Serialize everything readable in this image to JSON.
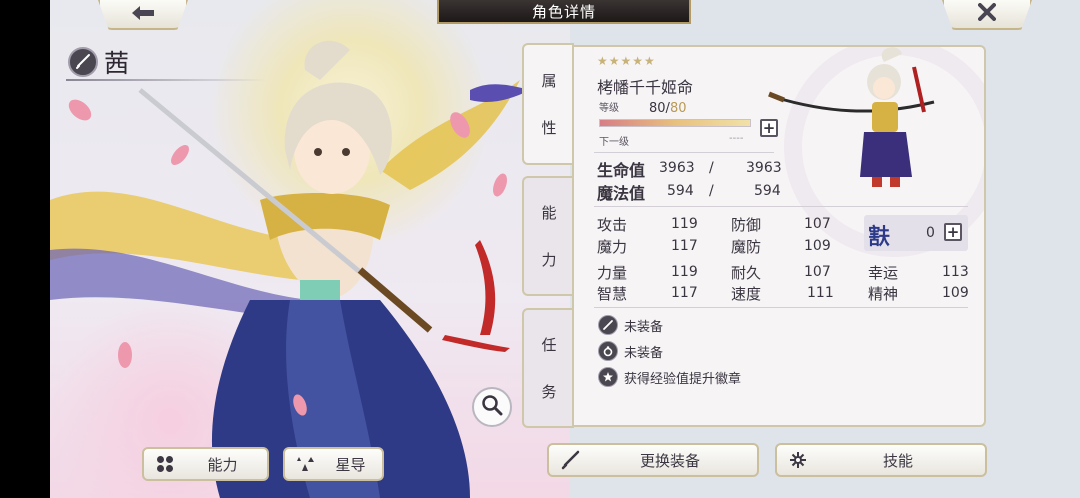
{
  "header": {
    "back_icon": "arrow-left-icon",
    "title": "角色详情",
    "close_icon": "close-x-icon"
  },
  "character": {
    "short_name": "茜",
    "full_name": "栲幡千千姬命",
    "stars": "★★★★★",
    "level_label": "等级",
    "level_current": "80",
    "level_sep": "/",
    "level_max": "80",
    "exp_progress": 1.0,
    "next_label": "下一级",
    "next_value": "----"
  },
  "tabs": {
    "attributes": [
      "属",
      "性"
    ],
    "ability": [
      "能",
      "力"
    ],
    "task": [
      "任",
      "务"
    ]
  },
  "stats": {
    "hp_label": "生命值",
    "hp_current": "3963",
    "hp_max": "3963",
    "mp_label": "魔法值",
    "mp_current": "594",
    "mp_max": "594",
    "slash": "/",
    "grid": [
      {
        "label": "攻击",
        "value": "119"
      },
      {
        "label": "防御",
        "value": "107"
      },
      {
        "label": "魔力",
        "value": "117"
      },
      {
        "label": "魔防",
        "value": "109"
      },
      {
        "label": "力量",
        "value": "119"
      },
      {
        "label": "耐久",
        "value": "107"
      },
      {
        "label": "幸运",
        "value": "113"
      },
      {
        "label": "智慧",
        "value": "117"
      },
      {
        "label": "速度",
        "value": "111"
      },
      {
        "label": "精神",
        "value": "109"
      }
    ],
    "rune_glyph": "㝬",
    "rune_value": "0"
  },
  "equipment": [
    {
      "icon": "sword-slot-icon",
      "label": "未装备"
    },
    {
      "icon": "ring-slot-icon",
      "label": "未装备"
    },
    {
      "icon": "badge-star-icon",
      "label": "获得经验值提升徽章"
    }
  ],
  "buttons": {
    "ability": "能力",
    "star_guide": "星导",
    "change_equipment": "更换装备",
    "skills": "技能"
  },
  "colors": {
    "accent_gold": "#c7b27a",
    "title_bg": "#2a2423",
    "panel_bg": "#f7f4f6",
    "rune_color": "#2c3a8a"
  }
}
